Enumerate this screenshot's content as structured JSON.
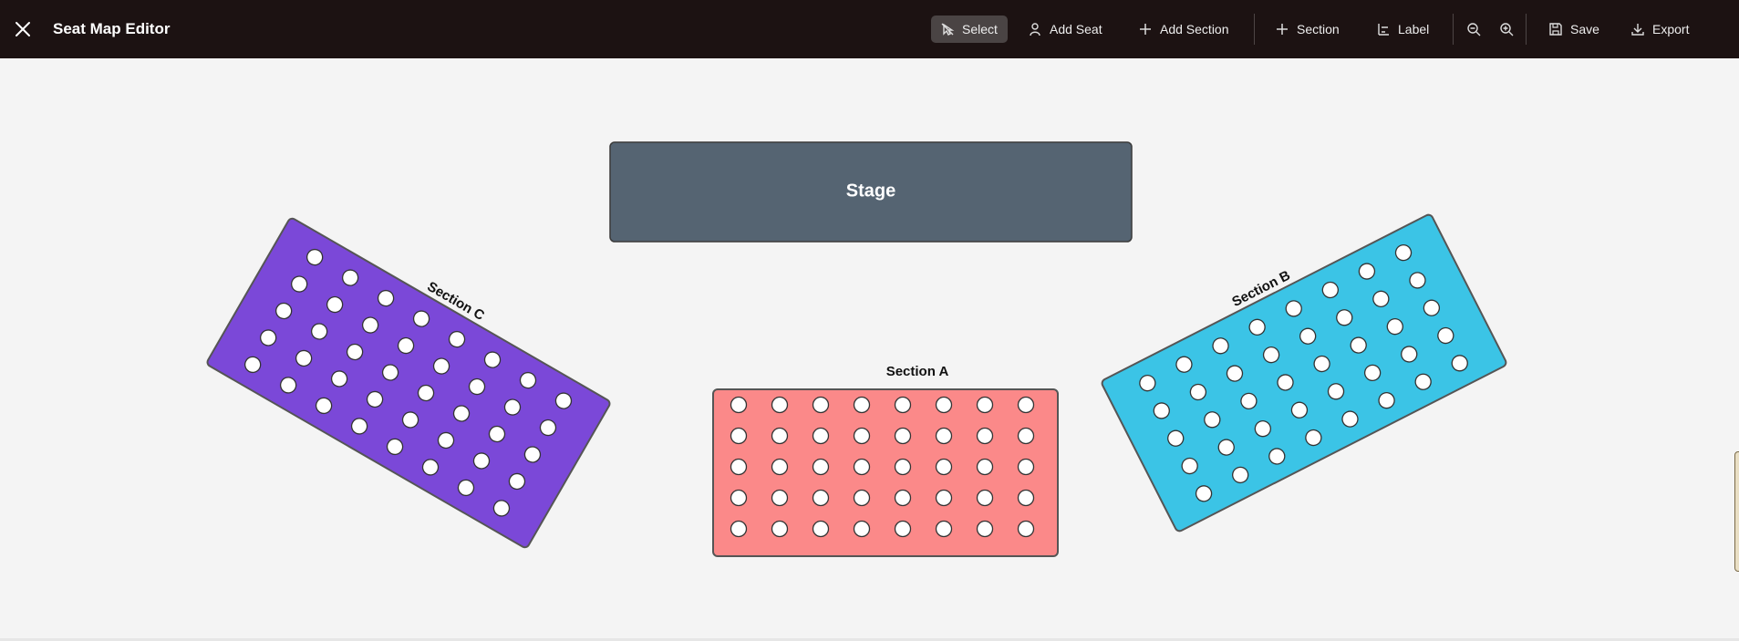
{
  "app": {
    "title": "Seat Map Editor"
  },
  "toolbar": {
    "select": "Select",
    "add_seat": "Add Seat",
    "add_section": "Add Section",
    "section": "Section",
    "label": "Label",
    "save": "Save",
    "export": "Export"
  },
  "canvas": {
    "stage": {
      "label": "Stage",
      "color": "#556472"
    },
    "sections": [
      {
        "name": "Section A",
        "label": "Section A",
        "color": "#fb8989",
        "rows": 5,
        "cols": 8
      },
      {
        "name": "Section B",
        "label": "Section B",
        "color": "#3bc4e6",
        "rows": 5,
        "cols": 8
      },
      {
        "name": "Section C",
        "label": "Section C",
        "color": "#7b48d8",
        "rows": 5,
        "cols": 8
      }
    ]
  },
  "colors": {
    "topbar": "#1c1212",
    "canvas": "#f4f4f4",
    "seat": "#ffffff",
    "seat_stroke": "#333333"
  }
}
